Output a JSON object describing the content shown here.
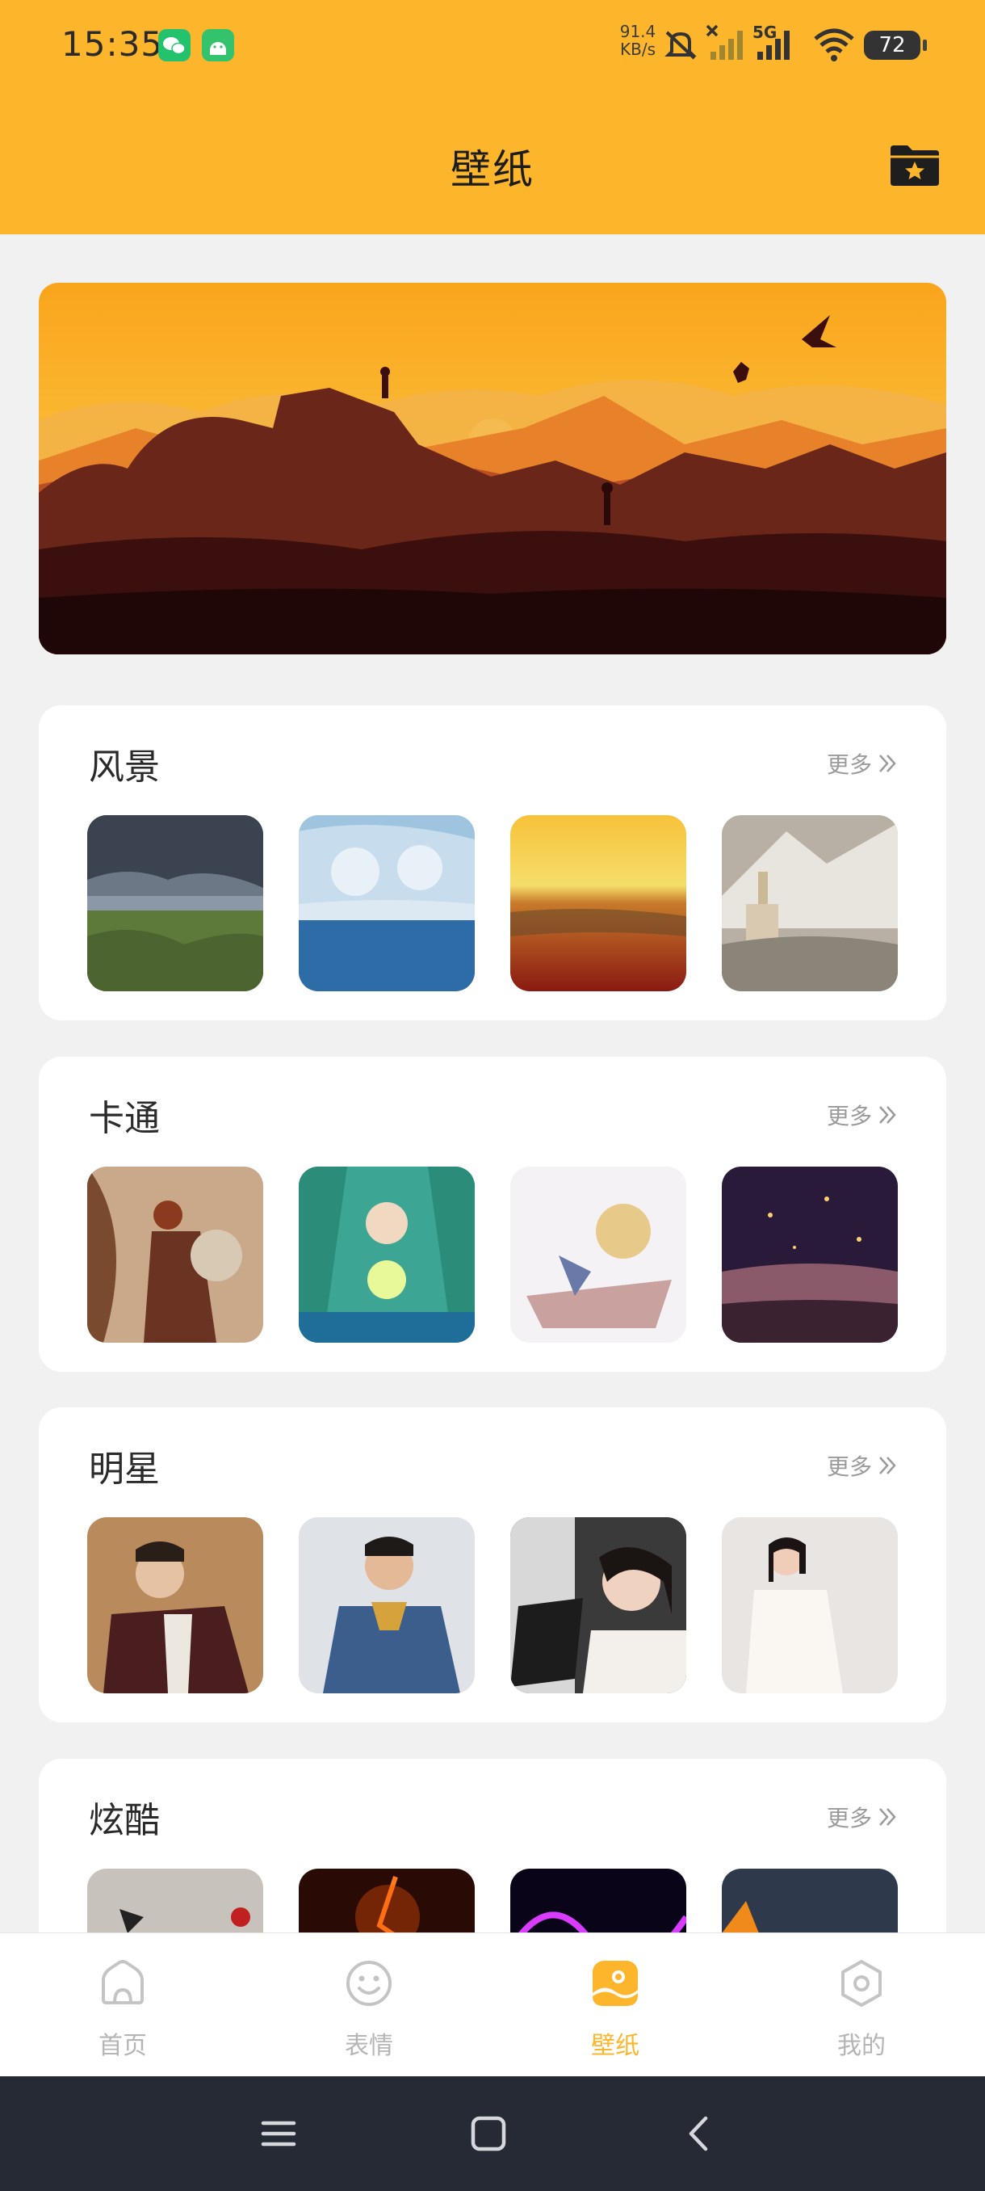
{
  "status_bar": {
    "time": "15:35",
    "net_speed_value": "91.4",
    "net_speed_unit": "KB/s",
    "network_label": "5G",
    "battery": "72",
    "notification_icons": [
      "wechat-icon",
      "android-icon"
    ]
  },
  "header": {
    "title": "壁纸",
    "action_icon": "folder-star-icon"
  },
  "sections": [
    {
      "title": "风景",
      "more": "更多"
    },
    {
      "title": "卡通",
      "more": "更多"
    },
    {
      "title": "明星",
      "more": "更多"
    },
    {
      "title": "炫酷",
      "more": "更多"
    }
  ],
  "bottom_nav": {
    "items": [
      {
        "label": "首页",
        "icon": "home-icon",
        "active": false
      },
      {
        "label": "表情",
        "icon": "smiley-icon",
        "active": false
      },
      {
        "label": "壁纸",
        "icon": "wallpaper-icon",
        "active": true
      },
      {
        "label": "我的",
        "icon": "hexagon-profile-icon",
        "active": false
      }
    ]
  },
  "system_nav": {
    "icons": [
      "menu-icon",
      "home-square-icon",
      "back-icon"
    ]
  },
  "colors": {
    "accent": "#FDB62B",
    "background": "#F1F1F1",
    "inactive": "#B5B5B5",
    "system_bar": "#252A35"
  }
}
